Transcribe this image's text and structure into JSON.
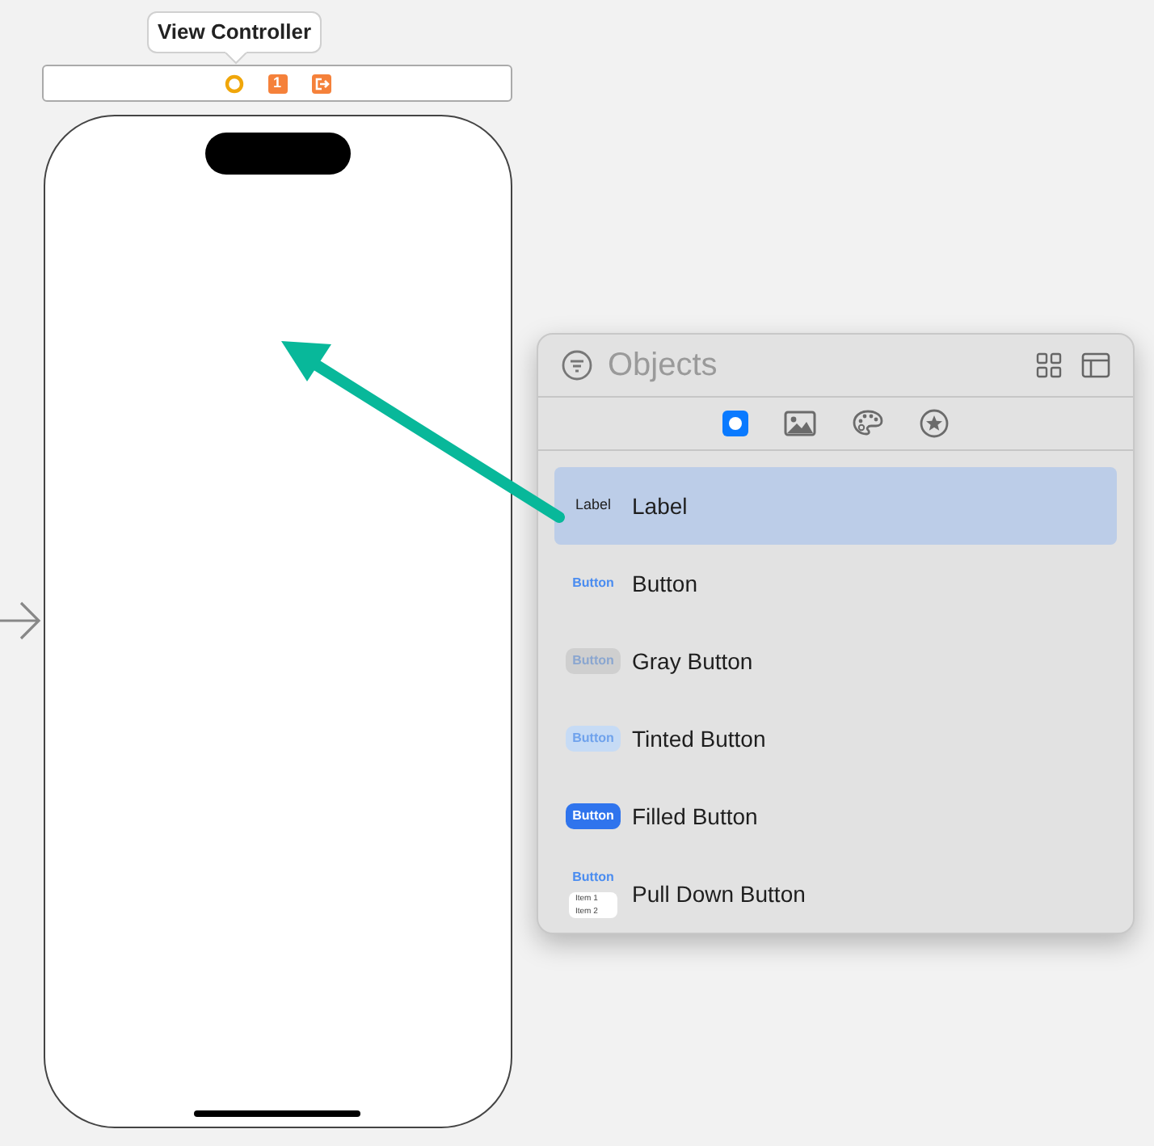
{
  "scene": {
    "title": "View Controller",
    "dock_badge": "1"
  },
  "library": {
    "title": "Objects",
    "tabs": [
      {
        "kind": "objects",
        "selected": true
      },
      {
        "kind": "media",
        "selected": false
      },
      {
        "kind": "colors",
        "selected": false
      },
      {
        "kind": "snippets",
        "selected": false
      }
    ],
    "items": [
      {
        "kind": "label",
        "thumb": "Label",
        "name": "Label",
        "selected": true
      },
      {
        "kind": "plain",
        "thumb": "Button",
        "name": "Button",
        "selected": false
      },
      {
        "kind": "gray",
        "thumb": "Button",
        "name": "Gray Button",
        "selected": false
      },
      {
        "kind": "tinted",
        "thumb": "Button",
        "name": "Tinted Button",
        "selected": false
      },
      {
        "kind": "filled",
        "thumb": "Button",
        "name": "Filled Button",
        "selected": false
      },
      {
        "kind": "pulldown",
        "thumb": "Button",
        "thumb_items": [
          "Item 1",
          "Item 2"
        ],
        "name": "Pull Down Button",
        "selected": false
      }
    ]
  }
}
